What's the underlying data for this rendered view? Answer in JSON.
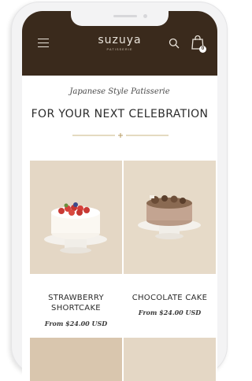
{
  "header": {
    "logo_text": "suzuya",
    "logo_subtext": "PATISSERIE",
    "cart_count": "0",
    "icons": {
      "menu": "hamburger-menu-icon",
      "search": "search-icon",
      "cart": "shopping-bag-icon"
    },
    "background_color": "#3a2a1c"
  },
  "section": {
    "subtitle": "Japanese Style Patisserie",
    "title": "FOR YOUR NEXT CELEBRATION"
  },
  "products": [
    {
      "name_line1": "STRAWBERRY",
      "name_line2": "SHORTCAKE",
      "price": "From $24.00 USD"
    },
    {
      "name_line1": "CHOCOLATE CAKE",
      "name_line2": "",
      "price": "From $24.00 USD"
    }
  ],
  "colors": {
    "accent_gold": "#c9b483",
    "text_dark": "#2b2b2b"
  }
}
